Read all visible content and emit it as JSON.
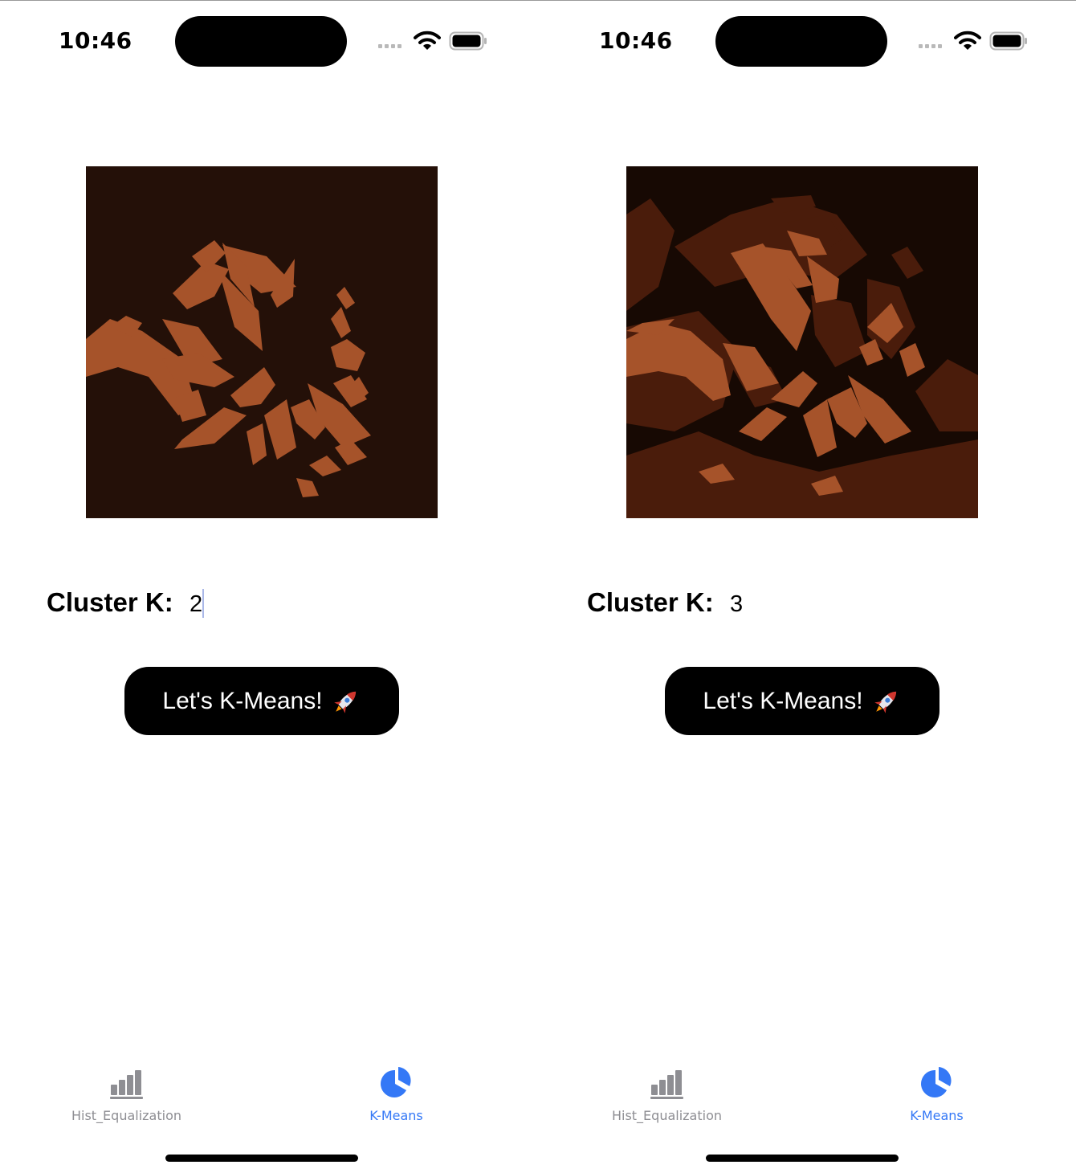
{
  "colors": {
    "accent": "#3478F6",
    "inactive_tab": "#8E8E93",
    "button_bg": "#000000",
    "cluster_dark": "#241008",
    "cluster_mid": "#4a1c0b",
    "cluster_light": "#a6532a"
  },
  "screens": [
    {
      "status": {
        "time": "10:46",
        "icons": [
          "signal-dots-icon",
          "wifi-icon",
          "battery-icon"
        ]
      },
      "image": {
        "kind": "k-means clustered image",
        "clusters": 2
      },
      "cluster": {
        "label": "Cluster K:",
        "value": "2"
      },
      "button": {
        "label": "Let's K-Means!",
        "emoji": "🚀"
      },
      "tabs": [
        {
          "label": "Hist_Equalization",
          "icon": "bar-chart-icon",
          "active": false
        },
        {
          "label": "K-Means",
          "icon": "pie-chart-icon",
          "active": true
        }
      ]
    },
    {
      "status": {
        "time": "10:46",
        "icons": [
          "signal-dots-icon",
          "wifi-icon",
          "battery-icon"
        ]
      },
      "image": {
        "kind": "k-means clustered image",
        "clusters": 3
      },
      "cluster": {
        "label": "Cluster K:",
        "value": "3"
      },
      "button": {
        "label": "Let's K-Means!",
        "emoji": "🚀"
      },
      "tabs": [
        {
          "label": "Hist_Equalization",
          "icon": "bar-chart-icon",
          "active": false
        },
        {
          "label": "K-Means",
          "icon": "pie-chart-icon",
          "active": true
        }
      ]
    }
  ]
}
